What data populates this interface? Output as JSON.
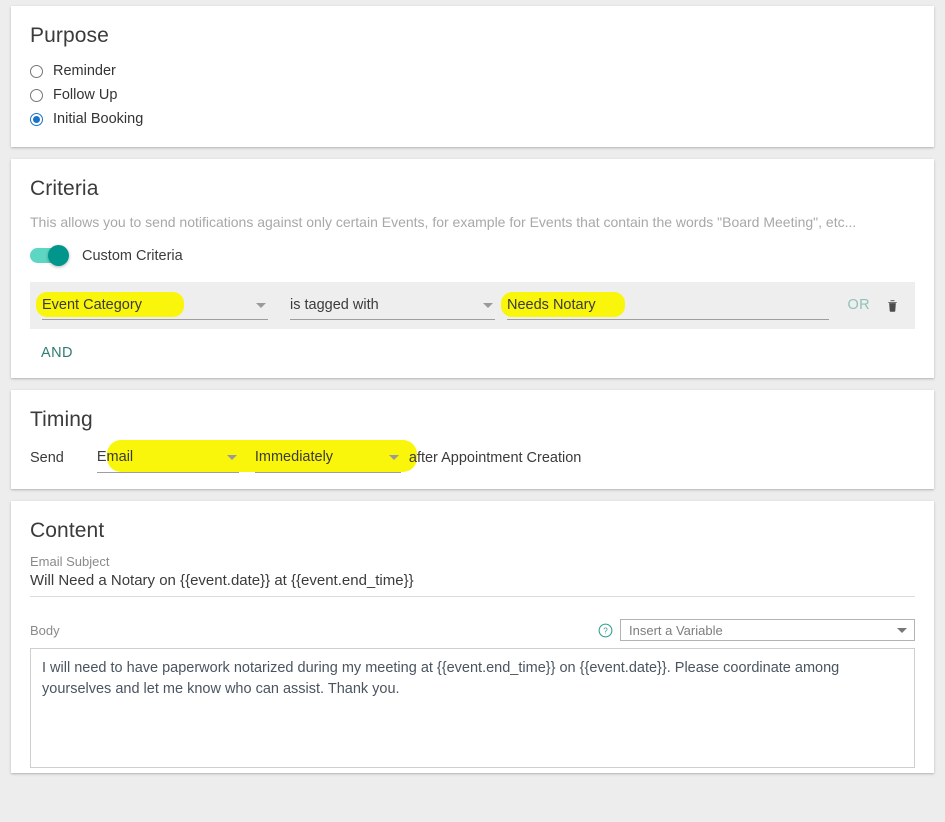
{
  "purpose": {
    "title": "Purpose",
    "options": [
      {
        "label": "Reminder",
        "selected": false
      },
      {
        "label": "Follow Up",
        "selected": false
      },
      {
        "label": "Initial Booking",
        "selected": true
      }
    ]
  },
  "criteria": {
    "title": "Criteria",
    "description": "This allows you to send notifications against only certain Events, for example for Events that contain the words \"Board Meeting\", etc...",
    "toggle_label": "Custom Criteria",
    "toggle_on": true,
    "rows": [
      {
        "category": "Event Category",
        "operator": "is tagged with",
        "value": "Needs Notary",
        "or_label": "OR",
        "delete_icon": "trash-icon"
      }
    ],
    "and_label": "AND"
  },
  "timing": {
    "title": "Timing",
    "prefix": "Send",
    "channel": "Email",
    "when": "Immediately",
    "suffix": "after Appointment Creation"
  },
  "content": {
    "title": "Content",
    "subject_label": "Email Subject",
    "subject_value": "Will Need a Notary on {{event.date}} at {{event.end_time}}",
    "subject_placeholder": "Email Subject",
    "body_label": "Body",
    "help_icon": "question-circle-icon",
    "variable_placeholder": "Insert a Variable",
    "body_value": "I will need to have paperwork notarized during my meeting at {{event.end_time}} on {{event.date}}. Please coordinate among yourselves and let me know who can assist. Thank you."
  },
  "colors": {
    "highlight": "#f9f50b",
    "accent_teal": "#2f7d72",
    "toggle_on": "#00968c",
    "radio_selected": "#1a73c7",
    "page_bg": "#ededed"
  }
}
